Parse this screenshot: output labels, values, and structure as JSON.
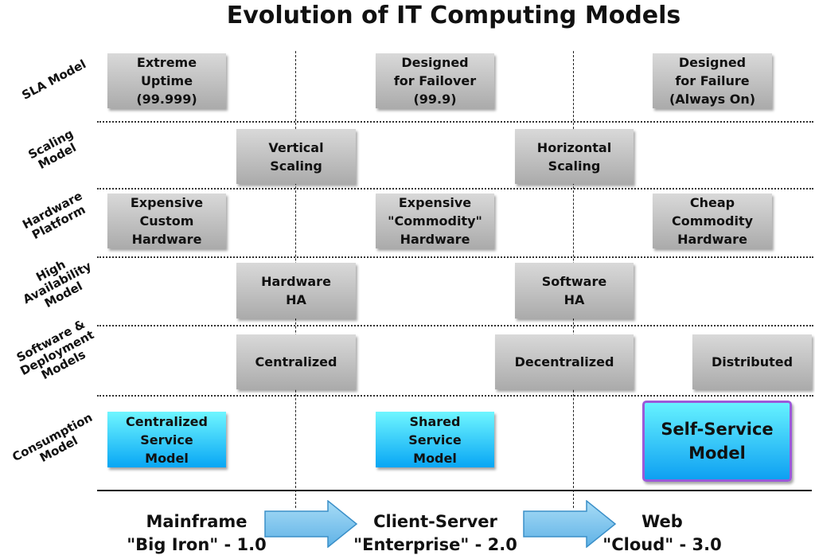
{
  "title": "Evolution of IT Computing Models",
  "rows": [
    {
      "label": "SLA Model"
    },
    {
      "label": "Scaling\nModel"
    },
    {
      "label": "Hardware\nPlatform"
    },
    {
      "label": "High\nAvailability\nModel"
    },
    {
      "label": "Software &\nDeployment\nModels"
    },
    {
      "label": "Consumption\nModel"
    }
  ],
  "boxes": {
    "sla": [
      "Extreme\nUptime\n(99.999)",
      "Designed\nfor Failover\n(99.9)",
      "Designed\nfor Failure\n(Always On)"
    ],
    "scaling": [
      "Vertical\nScaling",
      "Horizontal\nScaling"
    ],
    "hardware": [
      "Expensive\nCustom\nHardware",
      "Expensive\n\"Commodity\"\nHardware",
      "Cheap\nCommodity\nHardware"
    ],
    "ha": [
      "Hardware\nHA",
      "Software\nHA"
    ],
    "software": [
      "Centralized",
      "Decentralized",
      "Distributed"
    ],
    "consumption": [
      "Centralized\nService\nModel",
      "Shared\nService\nModel",
      "Self-Service\nModel"
    ]
  },
  "eras": [
    {
      "name": "Mainframe",
      "sub": "\"Big Iron\" - 1.0"
    },
    {
      "name": "Client-Server",
      "sub": "\"Enterprise\" - 2.0"
    },
    {
      "name": "Web",
      "sub": "\"Cloud\" - 3.0"
    }
  ],
  "colors": {
    "gray_box_top": "#d9d9d9",
    "gray_box_bottom": "#ababab",
    "blue_box_top": "#6ff6ff",
    "blue_box_bottom": "#08a6f4",
    "highlight_border": "#9b59d9",
    "arrow_fill": "#7cc4ec",
    "arrow_stroke": "#3a8fc8"
  }
}
